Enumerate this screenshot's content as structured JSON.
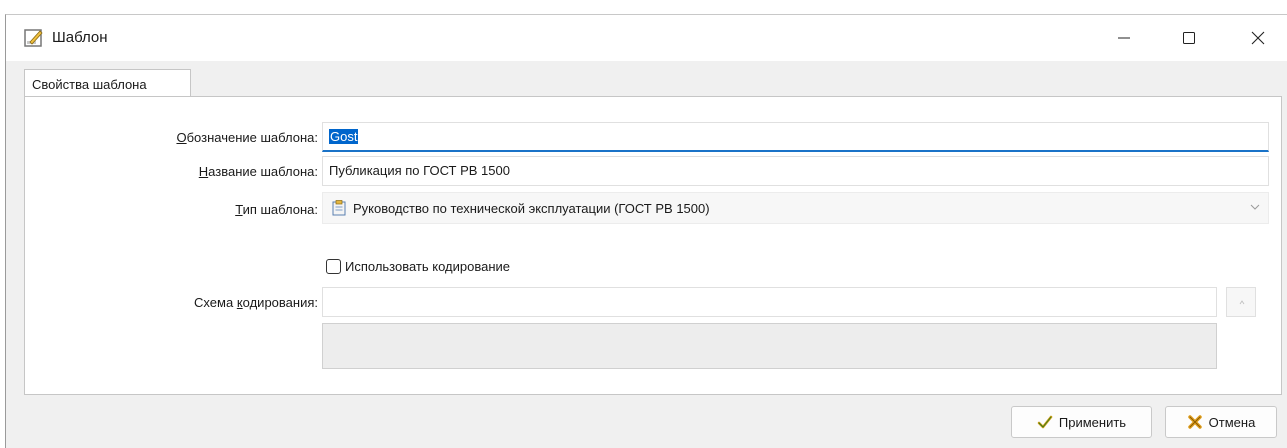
{
  "window": {
    "title": "Шаблон"
  },
  "tabs": [
    {
      "label": "Свойства шаблона",
      "active": true
    }
  ],
  "form": {
    "designation": {
      "label_u": "О",
      "label_rest": "бозначение шаблона:",
      "value": "Gost"
    },
    "name": {
      "label_u": "Н",
      "label_rest": "азвание шаблона:",
      "value": "Публикация по ГОСТ РВ 1500"
    },
    "type": {
      "label_u": "Т",
      "label_rest": "ип шаблона:",
      "value": "Руководство по технической эксплуатации (ГОСТ РВ 1500)"
    },
    "use_coding": {
      "label": "Использовать кодирование",
      "checked": false
    },
    "coding_scheme": {
      "label_pre": "Схема ",
      "label_u": "к",
      "label_rest": "одирования:",
      "value": ""
    }
  },
  "buttons": {
    "apply": "Применить",
    "cancel": "Отмена"
  },
  "colors": {
    "accent": "#0066cc",
    "focus_underline": "#1a73c8"
  }
}
